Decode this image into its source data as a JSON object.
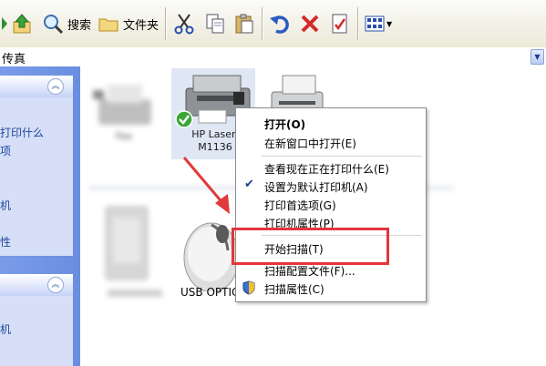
{
  "toolbar": {
    "search_label": "搜索",
    "folders_label": "文件夹"
  },
  "address": {
    "text": "传真"
  },
  "left_pane": {
    "group1_tasks": [
      "打印什么",
      "项",
      "机",
      "性"
    ],
    "group2_tasks": [
      "机"
    ]
  },
  "items": {
    "hp": {
      "line1": "HP LaserJ",
      "line2": "M1136"
    },
    "usb": {
      "label": "USB OPTIC"
    }
  },
  "context_menu": {
    "items": [
      {
        "label": "打开(O)",
        "bold": true
      },
      {
        "label": "在新窗口中打开(E)"
      },
      {
        "label": "查看现在正在打印什么(E)"
      },
      {
        "label": "设置为默认打印机(A)",
        "checked": true
      },
      {
        "label": "打印首选项(G)"
      },
      {
        "label": "打印机属性(P)"
      },
      {
        "label": "开始扫描(T)"
      },
      {
        "label": "扫描配置文件(F)..."
      },
      {
        "label": "扫描属性(C)"
      }
    ]
  },
  "colors": {
    "highlight_box": "#e3363c",
    "arrow": "#e03a3c",
    "pane": "#7a9ce8"
  }
}
